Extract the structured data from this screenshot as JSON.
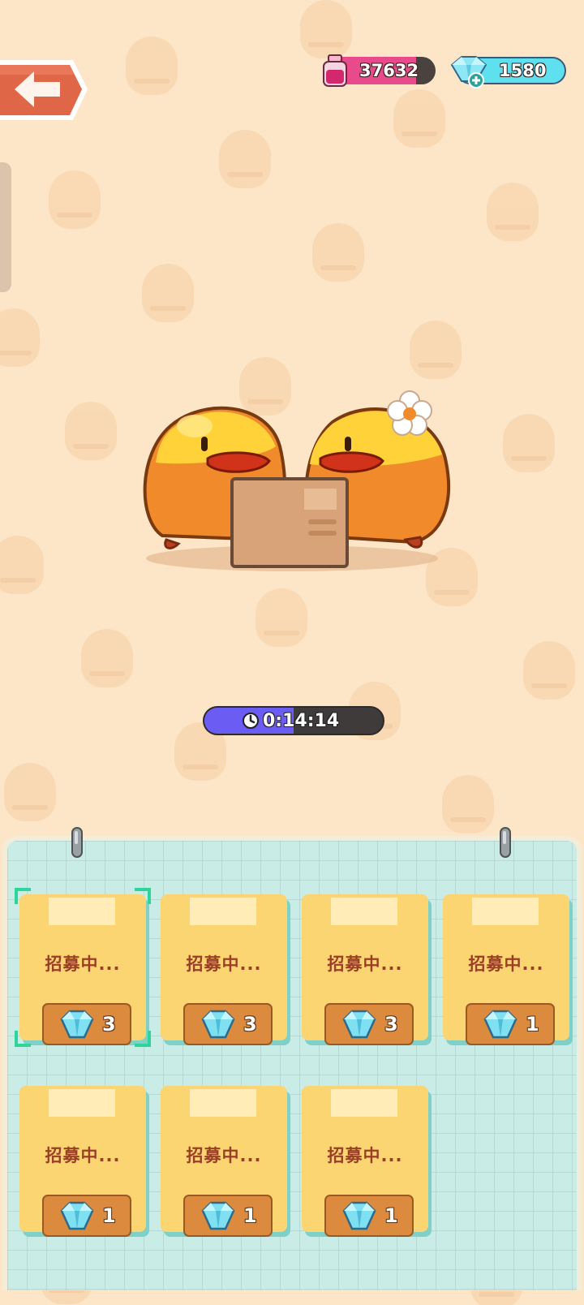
{
  "top_bar": {
    "ink_count": "37632",
    "gem_count": "1580"
  },
  "timer": {
    "time": "0:14:14",
    "progress": 0.5
  },
  "recruit_slots": [
    {
      "label": "招募中...",
      "cost": "3",
      "selected": true
    },
    {
      "label": "招募中...",
      "cost": "3",
      "selected": false
    },
    {
      "label": "招募中...",
      "cost": "3",
      "selected": false
    },
    {
      "label": "招募中...",
      "cost": "1",
      "selected": false
    },
    {
      "label": "招募中...",
      "cost": "1",
      "selected": false
    },
    {
      "label": "招募中...",
      "cost": "1",
      "selected": false
    },
    {
      "label": "招募中...",
      "cost": "1",
      "selected": false
    }
  ],
  "icons": {
    "back": "back-arrow-icon",
    "ink": "ink-bottle-icon",
    "gem": "gem-plus-icon",
    "clock": "clock-icon",
    "cost": "gem-icon"
  },
  "colors": {
    "background": "#fde6c8",
    "ink_bar": "#e84a8c",
    "gem_bar": "#5fe0ef",
    "timer_fill": "#6b5cf4",
    "card": "#fad571",
    "cost_badge": "#db8a3e",
    "board": "#c9ece6"
  }
}
